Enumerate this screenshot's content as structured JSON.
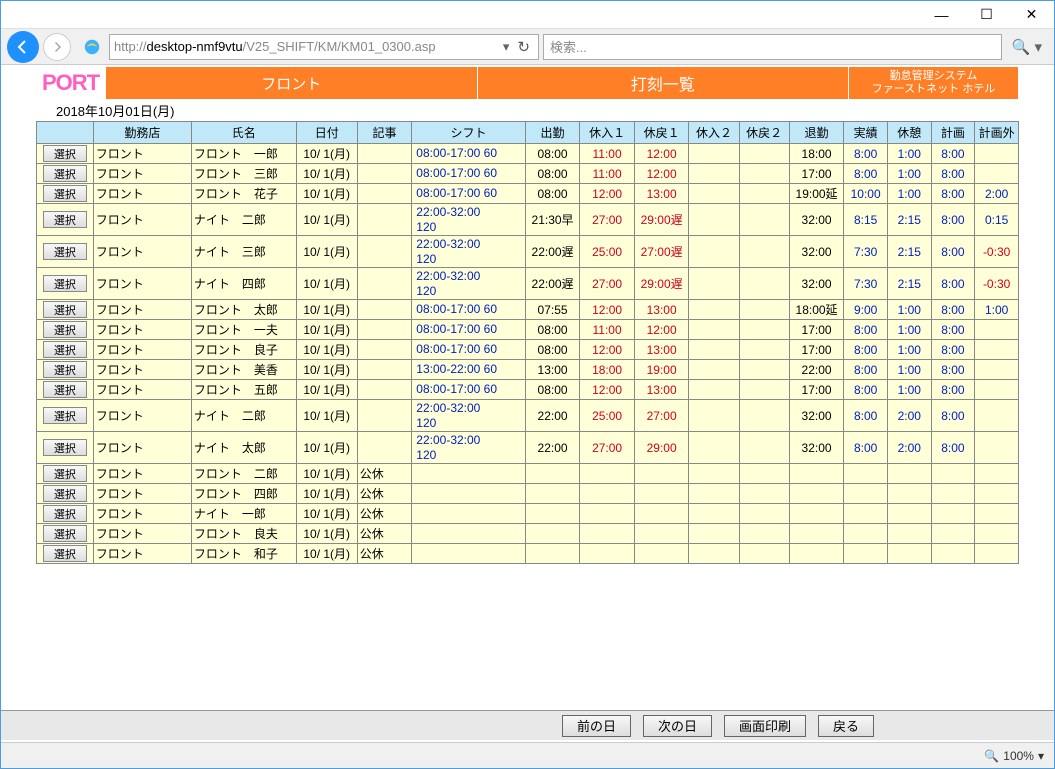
{
  "window": {
    "minimize": "—",
    "maximize": "☐",
    "close": "✕"
  },
  "addressbar": {
    "url_prefix": "http://",
    "url_host": "desktop-nmf9vtu",
    "url_path": "/V25_SHIFT/KM/KM01_0300.asp",
    "search_placeholder": "検索..."
  },
  "banner": {
    "logo": "PORT",
    "tab1": "フロント",
    "tab2": "打刻一覧",
    "tab3_line1": "勤怠管理システム",
    "tab3_line2": "ファーストネット ホテル"
  },
  "date_label": "2018年10月01日(月)",
  "select_button_label": "選択",
  "headers": [
    "",
    "勤務店",
    "氏名",
    "日付",
    "記事",
    "シフト",
    "出勤",
    "休入１",
    "休戻１",
    "休入２",
    "休戻２",
    "退勤",
    "実績",
    "休憩",
    "計画",
    "計画外"
  ],
  "rows": [
    {
      "store": "フロント",
      "name": "フロント　一郎",
      "date": "10/ 1(月)",
      "note": "",
      "shift": "08:00-17:00 60",
      "in": "08:00",
      "b1i": "11:00",
      "b1o": "12:00",
      "b2i": "",
      "b2o": "",
      "out": "18:00",
      "act": "8:00",
      "brk": "1:00",
      "plan": "8:00",
      "ext": "",
      "tall": false,
      "in_c": "",
      "b1i_c": "r",
      "b1o_c": "r",
      "out_c": "",
      "ext_c": ""
    },
    {
      "store": "フロント",
      "name": "フロント　三郎",
      "date": "10/ 1(月)",
      "note": "",
      "shift": "08:00-17:00 60",
      "in": "08:00",
      "b1i": "11:00",
      "b1o": "12:00",
      "b2i": "",
      "b2o": "",
      "out": "17:00",
      "act": "8:00",
      "brk": "1:00",
      "plan": "8:00",
      "ext": "",
      "tall": false,
      "in_c": "",
      "b1i_c": "r",
      "b1o_c": "r",
      "out_c": "",
      "ext_c": ""
    },
    {
      "store": "フロント",
      "name": "フロント　花子",
      "date": "10/ 1(月)",
      "note": "",
      "shift": "08:00-17:00 60",
      "in": "08:00",
      "b1i": "12:00",
      "b1o": "13:00",
      "b2i": "",
      "b2o": "",
      "out": "19:00延",
      "act": "10:00",
      "brk": "1:00",
      "plan": "8:00",
      "ext": "2:00",
      "tall": false,
      "in_c": "",
      "b1i_c": "r",
      "b1o_c": "r",
      "out_c": "",
      "ext_c": "b"
    },
    {
      "store": "フロント",
      "name": "ナイト　二郎",
      "date": "10/ 1(月)",
      "note": "",
      "shift": "22:00-32:00 120",
      "in": "21:30早",
      "b1i": "27:00",
      "b1o": "29:00遅",
      "b2i": "",
      "b2o": "",
      "out": "32:00",
      "act": "8:15",
      "brk": "2:15",
      "plan": "8:00",
      "ext": "0:15",
      "tall": true,
      "in_c": "",
      "b1i_c": "r",
      "b1o_c": "r",
      "out_c": "",
      "ext_c": "b"
    },
    {
      "store": "フロント",
      "name": "ナイト　三郎",
      "date": "10/ 1(月)",
      "note": "",
      "shift": "22:00-32:00 120",
      "in": "22:00遅",
      "b1i": "25:00",
      "b1o": "27:00遅",
      "b2i": "",
      "b2o": "",
      "out": "32:00",
      "act": "7:30",
      "brk": "2:15",
      "plan": "8:00",
      "ext": "-0:30",
      "tall": true,
      "in_c": "",
      "b1i_c": "r",
      "b1o_c": "r",
      "out_c": "",
      "ext_c": "r"
    },
    {
      "store": "フロント",
      "name": "ナイト　四郎",
      "date": "10/ 1(月)",
      "note": "",
      "shift": "22:00-32:00 120",
      "in": "22:00遅",
      "b1i": "27:00",
      "b1o": "29:00遅",
      "b2i": "",
      "b2o": "",
      "out": "32:00",
      "act": "7:30",
      "brk": "2:15",
      "plan": "8:00",
      "ext": "-0:30",
      "tall": true,
      "in_c": "",
      "b1i_c": "r",
      "b1o_c": "r",
      "out_c": "",
      "ext_c": "r"
    },
    {
      "store": "フロント",
      "name": "フロント　太郎",
      "date": "10/ 1(月)",
      "note": "",
      "shift": "08:00-17:00 60",
      "in": "07:55",
      "b1i": "12:00",
      "b1o": "13:00",
      "b2i": "",
      "b2o": "",
      "out": "18:00延",
      "act": "9:00",
      "brk": "1:00",
      "plan": "8:00",
      "ext": "1:00",
      "tall": false,
      "in_c": "",
      "b1i_c": "r",
      "b1o_c": "r",
      "out_c": "",
      "ext_c": "b"
    },
    {
      "store": "フロント",
      "name": "フロント　一夫",
      "date": "10/ 1(月)",
      "note": "",
      "shift": "08:00-17:00 60",
      "in": "08:00",
      "b1i": "11:00",
      "b1o": "12:00",
      "b2i": "",
      "b2o": "",
      "out": "17:00",
      "act": "8:00",
      "brk": "1:00",
      "plan": "8:00",
      "ext": "",
      "tall": false,
      "in_c": "",
      "b1i_c": "r",
      "b1o_c": "r",
      "out_c": "",
      "ext_c": ""
    },
    {
      "store": "フロント",
      "name": "フロント　良子",
      "date": "10/ 1(月)",
      "note": "",
      "shift": "08:00-17:00 60",
      "in": "08:00",
      "b1i": "12:00",
      "b1o": "13:00",
      "b2i": "",
      "b2o": "",
      "out": "17:00",
      "act": "8:00",
      "brk": "1:00",
      "plan": "8:00",
      "ext": "",
      "tall": false,
      "in_c": "",
      "b1i_c": "r",
      "b1o_c": "r",
      "out_c": "",
      "ext_c": ""
    },
    {
      "store": "フロント",
      "name": "フロント　美香",
      "date": "10/ 1(月)",
      "note": "",
      "shift": "13:00-22:00 60",
      "in": "13:00",
      "b1i": "18:00",
      "b1o": "19:00",
      "b2i": "",
      "b2o": "",
      "out": "22:00",
      "act": "8:00",
      "brk": "1:00",
      "plan": "8:00",
      "ext": "",
      "tall": false,
      "in_c": "",
      "b1i_c": "r",
      "b1o_c": "r",
      "out_c": "",
      "ext_c": ""
    },
    {
      "store": "フロント",
      "name": "フロント　五郎",
      "date": "10/ 1(月)",
      "note": "",
      "shift": "08:00-17:00 60",
      "in": "08:00",
      "b1i": "12:00",
      "b1o": "13:00",
      "b2i": "",
      "b2o": "",
      "out": "17:00",
      "act": "8:00",
      "brk": "1:00",
      "plan": "8:00",
      "ext": "",
      "tall": false,
      "in_c": "",
      "b1i_c": "r",
      "b1o_c": "r",
      "out_c": "",
      "ext_c": ""
    },
    {
      "store": "フロント",
      "name": "ナイト　二郎",
      "date": "10/ 1(月)",
      "note": "",
      "shift": "22:00-32:00 120",
      "in": "22:00",
      "b1i": "25:00",
      "b1o": "27:00",
      "b2i": "",
      "b2o": "",
      "out": "32:00",
      "act": "8:00",
      "brk": "2:00",
      "plan": "8:00",
      "ext": "",
      "tall": true,
      "in_c": "",
      "b1i_c": "r",
      "b1o_c": "r",
      "out_c": "",
      "ext_c": ""
    },
    {
      "store": "フロント",
      "name": "ナイト　太郎",
      "date": "10/ 1(月)",
      "note": "",
      "shift": "22:00-32:00 120",
      "in": "22:00",
      "b1i": "27:00",
      "b1o": "29:00",
      "b2i": "",
      "b2o": "",
      "out": "32:00",
      "act": "8:00",
      "brk": "2:00",
      "plan": "8:00",
      "ext": "",
      "tall": true,
      "in_c": "",
      "b1i_c": "r",
      "b1o_c": "r",
      "out_c": "",
      "ext_c": ""
    },
    {
      "store": "フロント",
      "name": "フロント　二郎",
      "date": "10/ 1(月)",
      "note": "公休",
      "shift": "",
      "in": "",
      "b1i": "",
      "b1o": "",
      "b2i": "",
      "b2o": "",
      "out": "",
      "act": "",
      "brk": "",
      "plan": "",
      "ext": "",
      "tall": false,
      "in_c": "",
      "b1i_c": "",
      "b1o_c": "",
      "out_c": "",
      "ext_c": ""
    },
    {
      "store": "フロント",
      "name": "フロント　四郎",
      "date": "10/ 1(月)",
      "note": "公休",
      "shift": "",
      "in": "",
      "b1i": "",
      "b1o": "",
      "b2i": "",
      "b2o": "",
      "out": "",
      "act": "",
      "brk": "",
      "plan": "",
      "ext": "",
      "tall": false,
      "in_c": "",
      "b1i_c": "",
      "b1o_c": "",
      "out_c": "",
      "ext_c": ""
    },
    {
      "store": "フロント",
      "name": "ナイト　一郎",
      "date": "10/ 1(月)",
      "note": "公休",
      "shift": "",
      "in": "",
      "b1i": "",
      "b1o": "",
      "b2i": "",
      "b2o": "",
      "out": "",
      "act": "",
      "brk": "",
      "plan": "",
      "ext": "",
      "tall": false,
      "in_c": "",
      "b1i_c": "",
      "b1o_c": "",
      "out_c": "",
      "ext_c": ""
    },
    {
      "store": "フロント",
      "name": "フロント　良夫",
      "date": "10/ 1(月)",
      "note": "公休",
      "shift": "",
      "in": "",
      "b1i": "",
      "b1o": "",
      "b2i": "",
      "b2o": "",
      "out": "",
      "act": "",
      "brk": "",
      "plan": "",
      "ext": "",
      "tall": false,
      "in_c": "",
      "b1i_c": "",
      "b1o_c": "",
      "out_c": "",
      "ext_c": ""
    },
    {
      "store": "フロント",
      "name": "フロント　和子",
      "date": "10/ 1(月)",
      "note": "公休",
      "shift": "",
      "in": "",
      "b1i": "",
      "b1o": "",
      "b2i": "",
      "b2o": "",
      "out": "",
      "act": "",
      "brk": "",
      "plan": "",
      "ext": "",
      "tall": false,
      "in_c": "",
      "b1i_c": "",
      "b1o_c": "",
      "out_c": "",
      "ext_c": ""
    }
  ],
  "buttons": {
    "prev_day": "前の日",
    "next_day": "次の日",
    "print": "画面印刷",
    "back": "戻る"
  },
  "status": {
    "zoom": "100%"
  }
}
